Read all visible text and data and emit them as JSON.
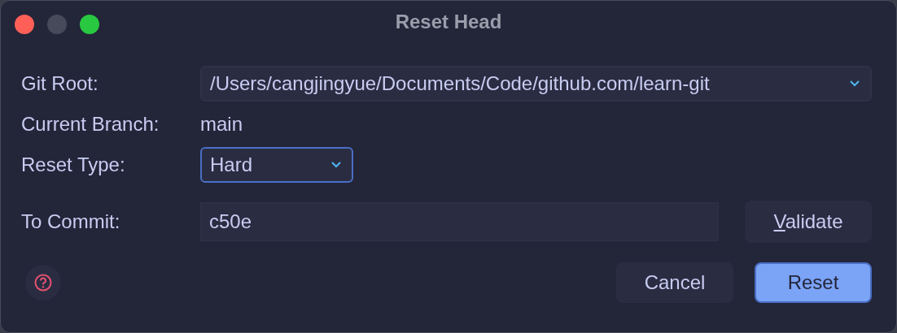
{
  "window": {
    "title": "Reset Head"
  },
  "git_root": {
    "label": "Git Root:",
    "value": "/Users/cangjingyue/Documents/Code/github.com/learn-git"
  },
  "current_branch": {
    "label": "Current Branch:",
    "value": "main"
  },
  "reset_type": {
    "label": "Reset Type:",
    "value": "Hard",
    "focused": true
  },
  "to_commit": {
    "label": "To Commit:",
    "value": "c50e"
  },
  "validate_button": {
    "label": "Validate",
    "first_letter_underlined": true
  },
  "buttons": [
    {
      "label": "Cancel",
      "default": false
    },
    {
      "label": "Reset",
      "default": true
    }
  ]
}
